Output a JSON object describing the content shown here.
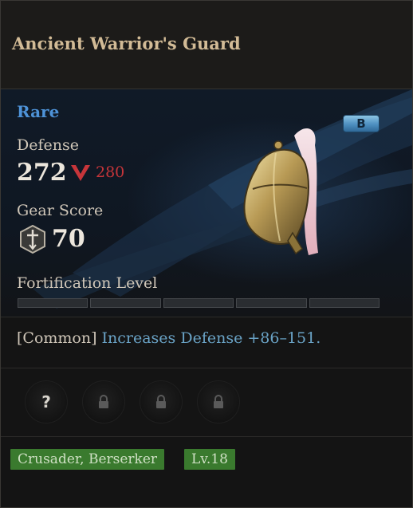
{
  "item": {
    "name": "Ancient Warrior's Guard",
    "rarity": "Rare",
    "grade_badge": "B"
  },
  "stats": {
    "defense_label": "Defense",
    "defense_value": "272",
    "defense_compare_value": "280",
    "gear_score_label": "Gear Score",
    "gear_score_value": "70",
    "fortification_label": "Fortification Level",
    "fortification_level": 0,
    "fortification_max": 5
  },
  "effect": {
    "tag": "[Common]",
    "text": "Increases Defense +86–151."
  },
  "sockets": [
    {
      "state": "unknown",
      "icon": "question-icon"
    },
    {
      "state": "locked",
      "icon": "lock-icon"
    },
    {
      "state": "locked",
      "icon": "lock-icon"
    },
    {
      "state": "locked",
      "icon": "lock-icon"
    }
  ],
  "requirements": {
    "classes": "Crusader, Berserker",
    "level": "Lv.18"
  },
  "colors": {
    "rarity": "#4e93d8",
    "stat_decrease": "#c7353a",
    "effect_text": "#6aa3c6",
    "requirement_tag": "#3a7a2e"
  }
}
